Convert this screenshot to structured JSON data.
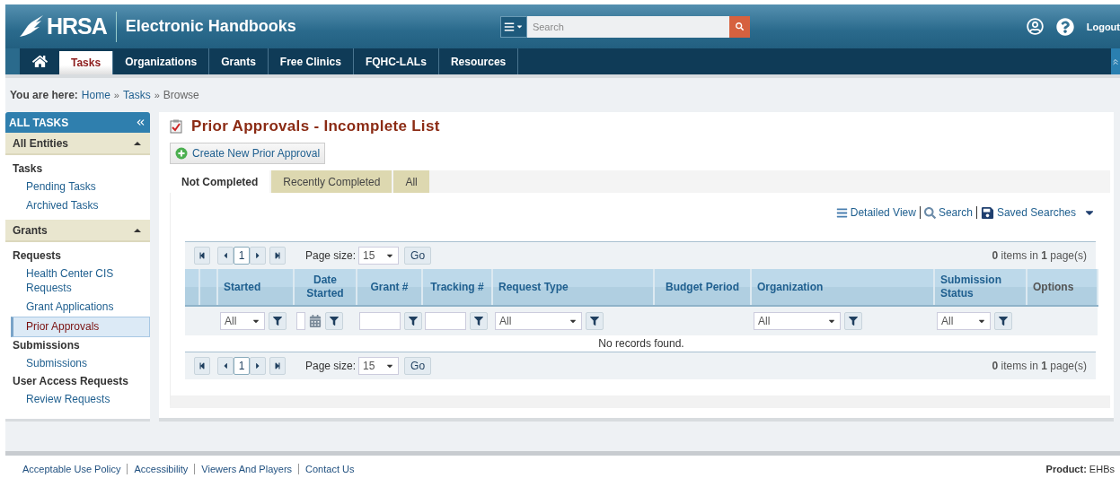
{
  "header": {
    "logo": "HRSA",
    "title": "Electronic Handbooks",
    "search": {
      "placeholder": "Search"
    },
    "logout": "Logout"
  },
  "nav": {
    "home_selected": false,
    "tabs": [
      {
        "label": "Tasks",
        "selected": true
      },
      {
        "label": "Organizations",
        "selected": false
      },
      {
        "label": "Grants",
        "selected": false
      },
      {
        "label": "Free Clinics",
        "selected": false
      },
      {
        "label": "FQHC-LALs",
        "selected": false
      },
      {
        "label": "Resources",
        "selected": false
      }
    ]
  },
  "breadcrumb": [
    {
      "kind": "label",
      "text": "You are here:"
    },
    {
      "kind": "link",
      "text": "Home"
    },
    {
      "kind": "sep",
      "text": "»"
    },
    {
      "kind": "link",
      "text": "Tasks"
    },
    {
      "kind": "sep",
      "text": "»"
    },
    {
      "kind": "current",
      "text": "Browse"
    }
  ],
  "sidebar": {
    "title": "ALL TASKS",
    "sections": [
      {
        "title": "All Entities",
        "expanded": true,
        "groups": [
          {
            "title": "Tasks",
            "items": [
              {
                "label": "Pending Tasks",
                "selected": false
              },
              {
                "label": "Archived Tasks",
                "selected": false
              }
            ]
          }
        ]
      },
      {
        "title": "Grants",
        "expanded": true,
        "groups": [
          {
            "title": "Requests",
            "items": [
              {
                "label": "Health Center CIS Requests",
                "selected": false
              },
              {
                "label": "Grant Applications",
                "selected": false
              },
              {
                "label": "Prior Approvals",
                "selected": true
              }
            ]
          },
          {
            "title": "Submissions",
            "items": [
              {
                "label": "Submissions",
                "selected": false
              }
            ]
          },
          {
            "title": "User Access Requests",
            "items": [
              {
                "label": "Review Requests",
                "selected": false
              }
            ]
          }
        ]
      }
    ]
  },
  "main": {
    "title": "Prior Approvals - Incomplete List",
    "create_button": "Create New Prior Approval",
    "tabs": [
      {
        "label": "Not Completed",
        "selected": true
      },
      {
        "label": "Recently Completed",
        "selected": false
      },
      {
        "label": "All",
        "selected": false
      }
    ],
    "toolbar": [
      {
        "kind": "detailed",
        "label": "Detailed View"
      },
      {
        "kind": "search",
        "label": "Search"
      },
      {
        "kind": "saved",
        "label": "Saved Searches"
      }
    ],
    "grid": {
      "pager": {
        "page": "1",
        "page_size_label": "Page size:",
        "page_size": "15",
        "go": "Go",
        "info": "**0** items in **1** page(s)"
      },
      "columns": [
        {
          "label": "Started",
          "sortable": true,
          "kind": "select",
          "value": "All"
        },
        {
          "label": "Date Started",
          "sortable": true,
          "kind": "date"
        },
        {
          "label": "Grant #",
          "sortable": true,
          "kind": "text"
        },
        {
          "label": "Tracking #",
          "sortable": true,
          "kind": "text"
        },
        {
          "label": "Request Type",
          "sortable": true,
          "kind": "select",
          "value": "All"
        },
        {
          "label": "Budget Period",
          "sortable": true,
          "kind": "plain"
        },
        {
          "label": "Organization",
          "sortable": true,
          "kind": "select",
          "value": "All"
        },
        {
          "label": "Submission Status",
          "sortable": true,
          "kind": "select",
          "value": "All"
        },
        {
          "label": "Options",
          "sortable": false,
          "kind": "plain"
        }
      ],
      "empty_message": "No records found.",
      "bottom_pager": {
        "page": "1",
        "page_size_label": "Page size:",
        "page_size": "15",
        "go": "Go",
        "info": "**0** items in **1** page(s)"
      }
    }
  },
  "footer": {
    "links": [
      "Acceptable Use Policy",
      "Accessibility",
      "Viewers And Players",
      "Contact Us"
    ],
    "product": "**Product:** EHBs"
  }
}
